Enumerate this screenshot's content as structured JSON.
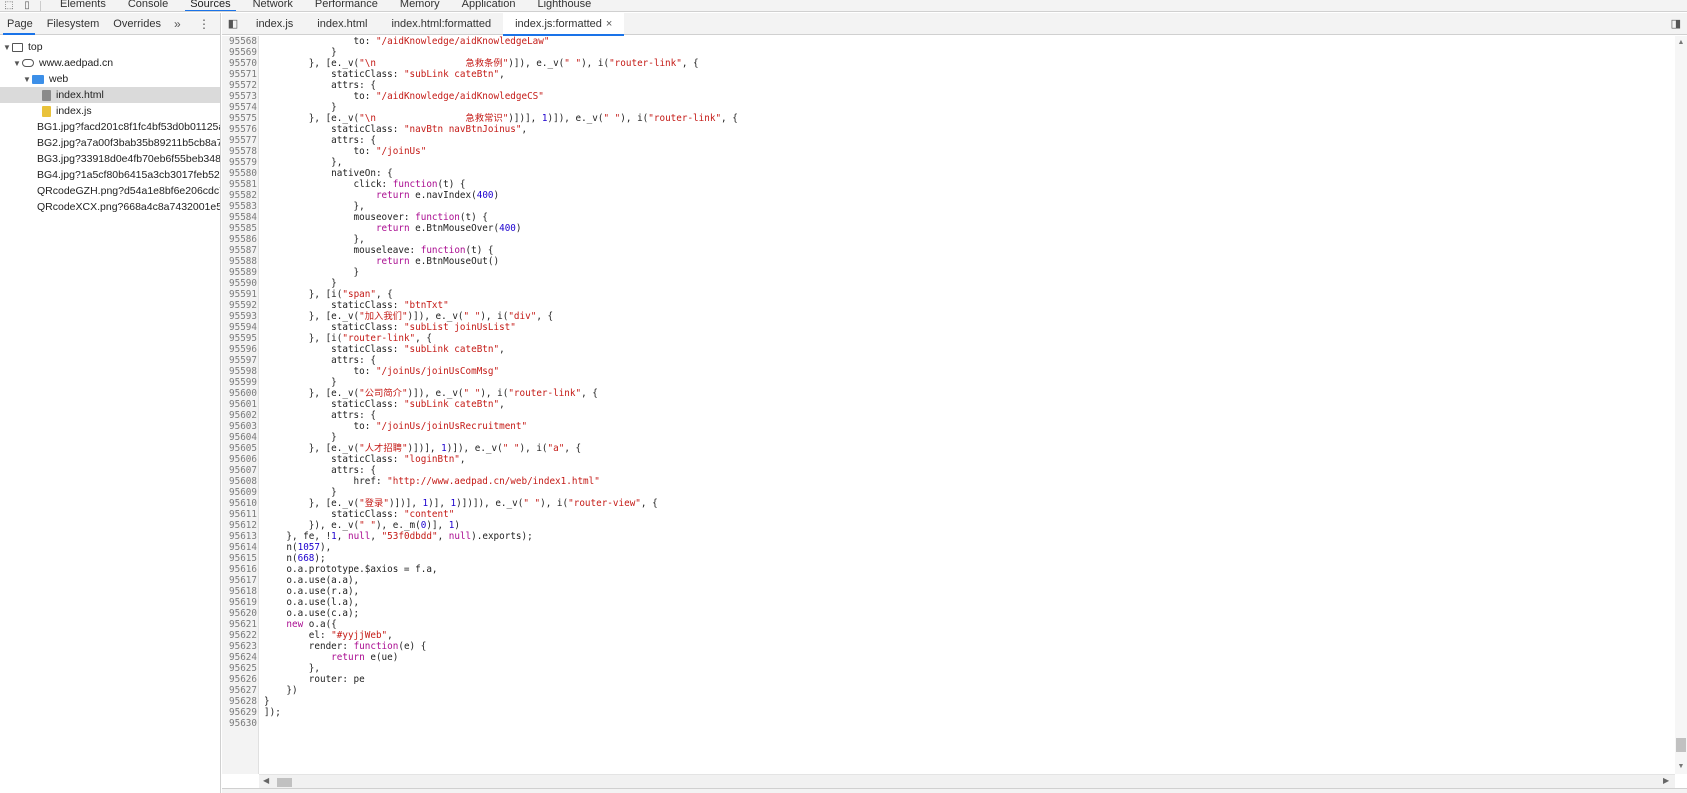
{
  "toolbar": {
    "tabs": [
      "Elements",
      "Console",
      "Sources",
      "Network",
      "Performance",
      "Memory",
      "Application",
      "Lighthouse"
    ],
    "active": "Sources"
  },
  "navigator": {
    "tabs": [
      "Page",
      "Filesystem",
      "Overrides"
    ],
    "more": "»",
    "tree": [
      {
        "label": "top",
        "type": "frame"
      },
      {
        "label": "www.aedpad.cn",
        "type": "domain"
      },
      {
        "label": "web",
        "type": "folder"
      },
      {
        "label": "index.html",
        "type": "html"
      },
      {
        "label": "index.js",
        "type": "js"
      },
      {
        "label": "BG1.jpg?facd201c8f1fc4bf53d0b01125a",
        "type": "img"
      },
      {
        "label": "BG2.jpg?a7a00f3bab35b89211b5cb8a7",
        "type": "img"
      },
      {
        "label": "BG3.jpg?33918d0e4fb70eb6f55beb348",
        "type": "img"
      },
      {
        "label": "BG4.jpg?1a5cf80b6415a3cb3017feb523",
        "type": "img"
      },
      {
        "label": "QRcodeGZH.png?d54a1e8bf6e206cdc7",
        "type": "img"
      },
      {
        "label": "QRcodeXCX.png?668a4c8a7432001e5c",
        "type": "img"
      }
    ]
  },
  "editor_tabs": [
    "index.js",
    "index.html",
    "index.html:formatted",
    "index.js:formatted"
  ],
  "editor_close": "×",
  "code": [
    {
      "n": "95568",
      "t": "                to: \"/aidKnowledge/aidKnowledgeLaw\""
    },
    {
      "n": "95569",
      "t": "            }"
    },
    {
      "n": "95570",
      "t": "        }, [e._v(\"\\n                急救条例\")]), e._v(\" \"), i(\"router-link\", {"
    },
    {
      "n": "95571",
      "t": "            staticClass: \"subLink cateBtn\","
    },
    {
      "n": "95572",
      "t": "            attrs: {"
    },
    {
      "n": "95573",
      "t": "                to: \"/aidKnowledge/aidKnowledgeCS\""
    },
    {
      "n": "95574",
      "t": "            }"
    },
    {
      "n": "95575",
      "t": "        }, [e._v(\"\\n                急救常识\")])], 1)]), e._v(\" \"), i(\"router-link\", {"
    },
    {
      "n": "95576",
      "t": "            staticClass: \"navBtn navBtnJoinus\","
    },
    {
      "n": "95577",
      "t": "            attrs: {"
    },
    {
      "n": "95578",
      "t": "                to: \"/joinUs\""
    },
    {
      "n": "95579",
      "t": "            },"
    },
    {
      "n": "95580",
      "t": "            nativeOn: {"
    },
    {
      "n": "95581",
      "t": "                click: function(t) {"
    },
    {
      "n": "95582",
      "t": "                    return e.navIndex(400)"
    },
    {
      "n": "95583",
      "t": "                },"
    },
    {
      "n": "95584",
      "t": "                mouseover: function(t) {"
    },
    {
      "n": "95585",
      "t": "                    return e.BtnMouseOver(400)"
    },
    {
      "n": "95586",
      "t": "                },"
    },
    {
      "n": "95587",
      "t": "                mouseleave: function(t) {"
    },
    {
      "n": "95588",
      "t": "                    return e.BtnMouseOut()"
    },
    {
      "n": "95589",
      "t": "                }"
    },
    {
      "n": "95590",
      "t": "            }"
    },
    {
      "n": "95591",
      "t": "        }, [i(\"span\", {"
    },
    {
      "n": "95592",
      "t": "            staticClass: \"btnTxt\""
    },
    {
      "n": "95593",
      "t": "        }, [e._v(\"加入我们\")]), e._v(\" \"), i(\"div\", {"
    },
    {
      "n": "95594",
      "t": "            staticClass: \"subList joinUsList\""
    },
    {
      "n": "95595",
      "t": "        }, [i(\"router-link\", {"
    },
    {
      "n": "95596",
      "t": "            staticClass: \"subLink cateBtn\","
    },
    {
      "n": "95597",
      "t": "            attrs: {"
    },
    {
      "n": "95598",
      "t": "                to: \"/joinUs/joinUsComMsg\""
    },
    {
      "n": "95599",
      "t": "            }"
    },
    {
      "n": "95600",
      "t": "        }, [e._v(\"公司简介\")]), e._v(\" \"), i(\"router-link\", {"
    },
    {
      "n": "95601",
      "t": "            staticClass: \"subLink cateBtn\","
    },
    {
      "n": "95602",
      "t": "            attrs: {"
    },
    {
      "n": "95603",
      "t": "                to: \"/joinUs/joinUsRecruitment\""
    },
    {
      "n": "95604",
      "t": "            }"
    },
    {
      "n": "95605",
      "t": "        }, [e._v(\"人才招聘\")])], 1)]), e._v(\" \"), i(\"a\", {"
    },
    {
      "n": "95606",
      "t": "            staticClass: \"loginBtn\","
    },
    {
      "n": "95607",
      "t": "            attrs: {"
    },
    {
      "n": "95608",
      "t": "                href: \"http://www.aedpad.cn/web/index1.html\""
    },
    {
      "n": "95609",
      "t": "            }"
    },
    {
      "n": "95610",
      "t": "        }, [e._v(\"登录\")])], 1)], 1)])]), e._v(\" \"), i(\"router-view\", {"
    },
    {
      "n": "95611",
      "t": "            staticClass: \"content\""
    },
    {
      "n": "95612",
      "t": "        }), e._v(\" \"), e._m(0)], 1)"
    },
    {
      "n": "95613",
      "t": "    }, fe, !1, null, \"53f0dbdd\", null).exports);"
    },
    {
      "n": "95614",
      "t": "    n(1057),"
    },
    {
      "n": "95615",
      "t": "    n(668);"
    },
    {
      "n": "95616",
      "t": "    o.a.prototype.$axios = f.a,"
    },
    {
      "n": "95617",
      "t": "    o.a.use(a.a),"
    },
    {
      "n": "95618",
      "t": "    o.a.use(r.a),"
    },
    {
      "n": "95619",
      "t": "    o.a.use(l.a),"
    },
    {
      "n": "95620",
      "t": "    o.a.use(c.a);"
    },
    {
      "n": "95621",
      "t": "    new o.a({"
    },
    {
      "n": "95622",
      "t": "        el: \"#yyjjWeb\","
    },
    {
      "n": "95623",
      "t": "        render: function(e) {"
    },
    {
      "n": "95624",
      "t": "            return e(ue)"
    },
    {
      "n": "95625",
      "t": "        },"
    },
    {
      "n": "95626",
      "t": "        router: pe"
    },
    {
      "n": "95627",
      "t": "    })"
    },
    {
      "n": "95628",
      "t": "}"
    },
    {
      "n": "95629",
      "t": "]);"
    },
    {
      "n": "95630",
      "t": ""
    }
  ],
  "colors": {
    "accent": "#1a73e8",
    "string": "#c41a16",
    "keyword": "#aa0d91",
    "number": "#1c00cf"
  }
}
